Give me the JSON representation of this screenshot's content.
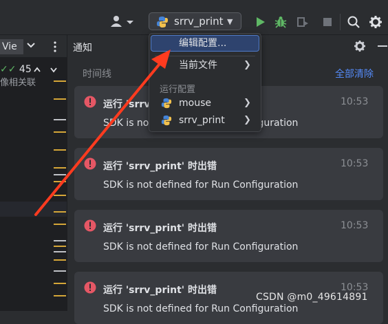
{
  "toolbar": {
    "run_config_name": "srrv_print",
    "icons": [
      "user-icon",
      "python-icon",
      "run-icon",
      "debug-icon",
      "coverage-icon",
      "stop-icon",
      "search-icon",
      "gear-icon"
    ]
  },
  "left_panel": {
    "view_label": "Vie",
    "check_count": "45",
    "code_snippet": "像相关联"
  },
  "notifications": {
    "title": "通知",
    "timeline_label": "时间线",
    "clear_all": "全部清除",
    "items": [
      {
        "title": "运行 'srrv_print' 时出错",
        "time": "10:53",
        "body": "SDK is not defined for Run Configuration"
      },
      {
        "title": "运行 'srrv_print' 时出错",
        "time": "10:53",
        "body": "SDK is not defined for Run Configuration"
      },
      {
        "title": "运行 'srrv_print' 时出错",
        "time": "10:53",
        "body": "SDK is not defined for Run Configuration"
      },
      {
        "title": "运行 'srrv_print' 时出错",
        "time": "10:53",
        "body": "SDK is not defined for Run Configuration"
      }
    ]
  },
  "dropdown": {
    "edit_config": "编辑配置...",
    "current_file": "当前文件",
    "section_label": "运行配置",
    "configs": [
      "mouse",
      "srrv_print"
    ]
  },
  "colors": {
    "accent": "#548af7",
    "error": "#e55765",
    "run_green": "#5fb865",
    "arrow_red": "#ff3b1f"
  },
  "watermark": "CSDN @m0_49614891"
}
